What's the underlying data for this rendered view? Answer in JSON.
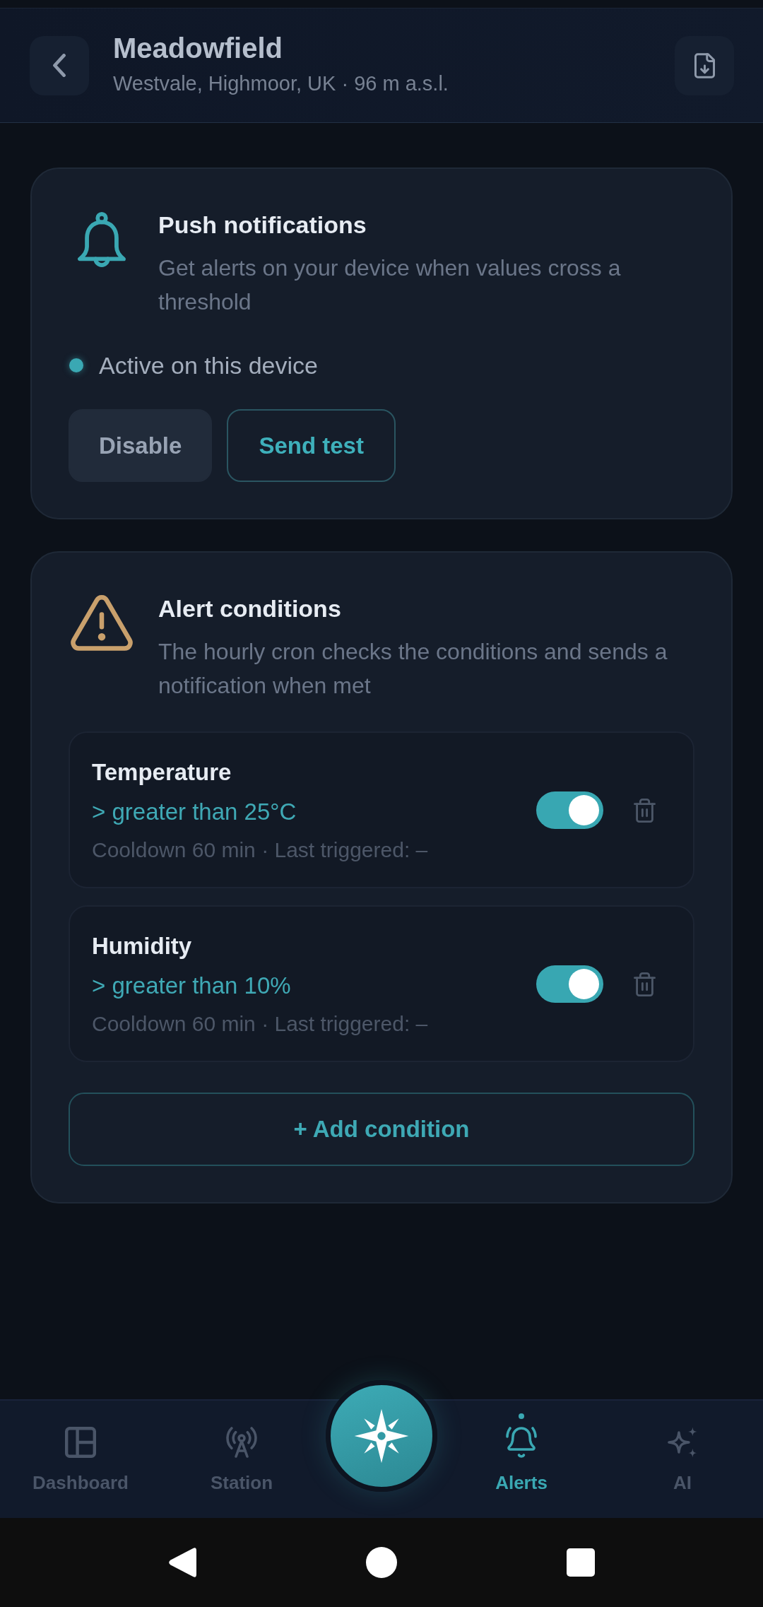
{
  "header": {
    "title": "Meadowfield",
    "subtitle": "Westvale, Highmoor, UK · 96 m a.s.l."
  },
  "push_notifications": {
    "title": "Push notifications",
    "description": "Get alerts on your device when values cross a threshold",
    "status": {
      "label": "Active on this device",
      "on": true
    },
    "buttons": [
      {
        "label": "Disable",
        "kind": "secondary"
      },
      {
        "label": "Send test",
        "kind": "outline"
      }
    ]
  },
  "alert_conditions": {
    "title": "Alert conditions",
    "description": "The hourly cron checks the conditions and sends a notification when met",
    "conditions": [
      {
        "name": "Temperature",
        "rule": "> greater than 25°C",
        "details": "Cooldown 60 min · Last triggered: –",
        "on": true
      },
      {
        "name": "Humidity",
        "rule": "> greater than 10%",
        "details": "Cooldown 60 min · Last triggered: –",
        "on": true
      }
    ],
    "add_button": "+ Add condition"
  },
  "bottom_nav": {
    "items": [
      {
        "kind": "tab",
        "label": "Dashboard",
        "selected": false
      },
      {
        "kind": "tab",
        "label": "Station",
        "selected": false
      },
      {
        "kind": "action"
      },
      {
        "kind": "tab",
        "label": "Alerts",
        "selected": true
      },
      {
        "kind": "tab",
        "label": "AI",
        "selected": false
      }
    ]
  }
}
